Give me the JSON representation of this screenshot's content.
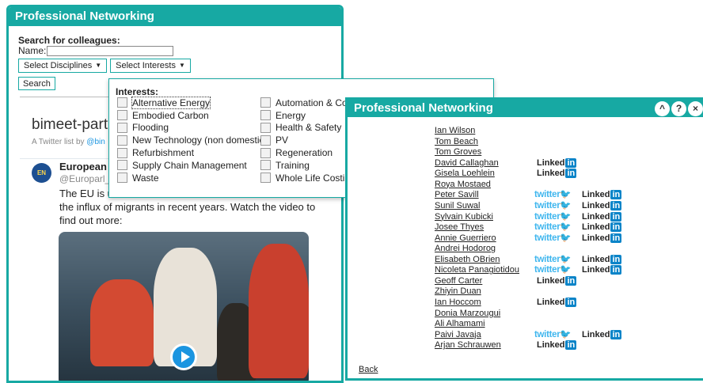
{
  "left_widget": {
    "title": "Professional Networking",
    "search_heading": "Search for colleagues:",
    "name_label": "Name:",
    "name_value": "",
    "select_disciplines": "Select Disciplines",
    "select_interests": "Select Interests",
    "search_button": "Search"
  },
  "twitter_list": {
    "title": "bimeet-partr",
    "by_prefix": "A Twitter list by ",
    "by_handle": "@bin",
    "avatar_text": "EN",
    "tweet_author": "European P",
    "tweet_handle": "@Europarl_",
    "tweet_text_line1": "The EU is u",
    "tweet_text_line2": "the influx of migrants in recent years. Watch the video to",
    "tweet_text_line3": "find out more:"
  },
  "interests": {
    "title": "Interests:",
    "column1": [
      "Alternative Energy",
      "Embodied Carbon",
      "Flooding",
      "New Technology (non domestic)",
      "Refurbishment",
      "Supply Chain Management",
      "Waste"
    ],
    "column2": [
      "Automation & Co",
      "Energy",
      "Health & Safety",
      "PV",
      "Regeneration",
      "Training",
      "Whole Life Costin"
    ]
  },
  "right_widget": {
    "title": "Professional Networking",
    "ctrl_up": "^",
    "ctrl_help": "?",
    "ctrl_close": "×",
    "twitter_text": "twitter",
    "twitter_bird": "🐦",
    "linkedin_text": "Linked",
    "linkedin_box": "in",
    "people": [
      {
        "name": "Ian Wilson"
      },
      {
        "name": "Tom Beach"
      },
      {
        "name": "Tom Groves"
      },
      {
        "name": "David Callaghan",
        "linkedin": true
      },
      {
        "name": "Gisela Loehlein",
        "linkedin": true
      },
      {
        "name": "Roya Mostaed"
      },
      {
        "name": "Peter Savill",
        "twitter": true,
        "linkedin": true
      },
      {
        "name": "Sunil Suwal",
        "twitter": true,
        "linkedin": true
      },
      {
        "name": "Sylvain Kubicki",
        "twitter": true,
        "linkedin": true
      },
      {
        "name": "Josee Thyes",
        "twitter": true,
        "linkedin": true
      },
      {
        "name": "Annie Guerriero",
        "twitter": true,
        "linkedin": true
      },
      {
        "name": "Andrei Hodorog"
      },
      {
        "name": "Elisabeth OBrien",
        "twitter": true,
        "linkedin": true
      },
      {
        "name": "Nicoleta Panagiotidou",
        "twitter": true,
        "linkedin": true
      },
      {
        "name": "Geoff Carter",
        "linkedin": true
      },
      {
        "name": "Zhiyin Duan"
      },
      {
        "name": "Ian Hoccom",
        "linkedin": true
      },
      {
        "name": "Donia Marzougui"
      },
      {
        "name": "Ali Alhamami"
      },
      {
        "name": "Paivi Javaja",
        "twitter": true,
        "linkedin": true
      },
      {
        "name": "Arjan Schrauwen",
        "linkedin": true
      }
    ],
    "back_link": "Back"
  },
  "colors": {
    "accent": "#17a9a3",
    "twitter": "#3fb6ee",
    "linkedin": "#0a84c8"
  }
}
